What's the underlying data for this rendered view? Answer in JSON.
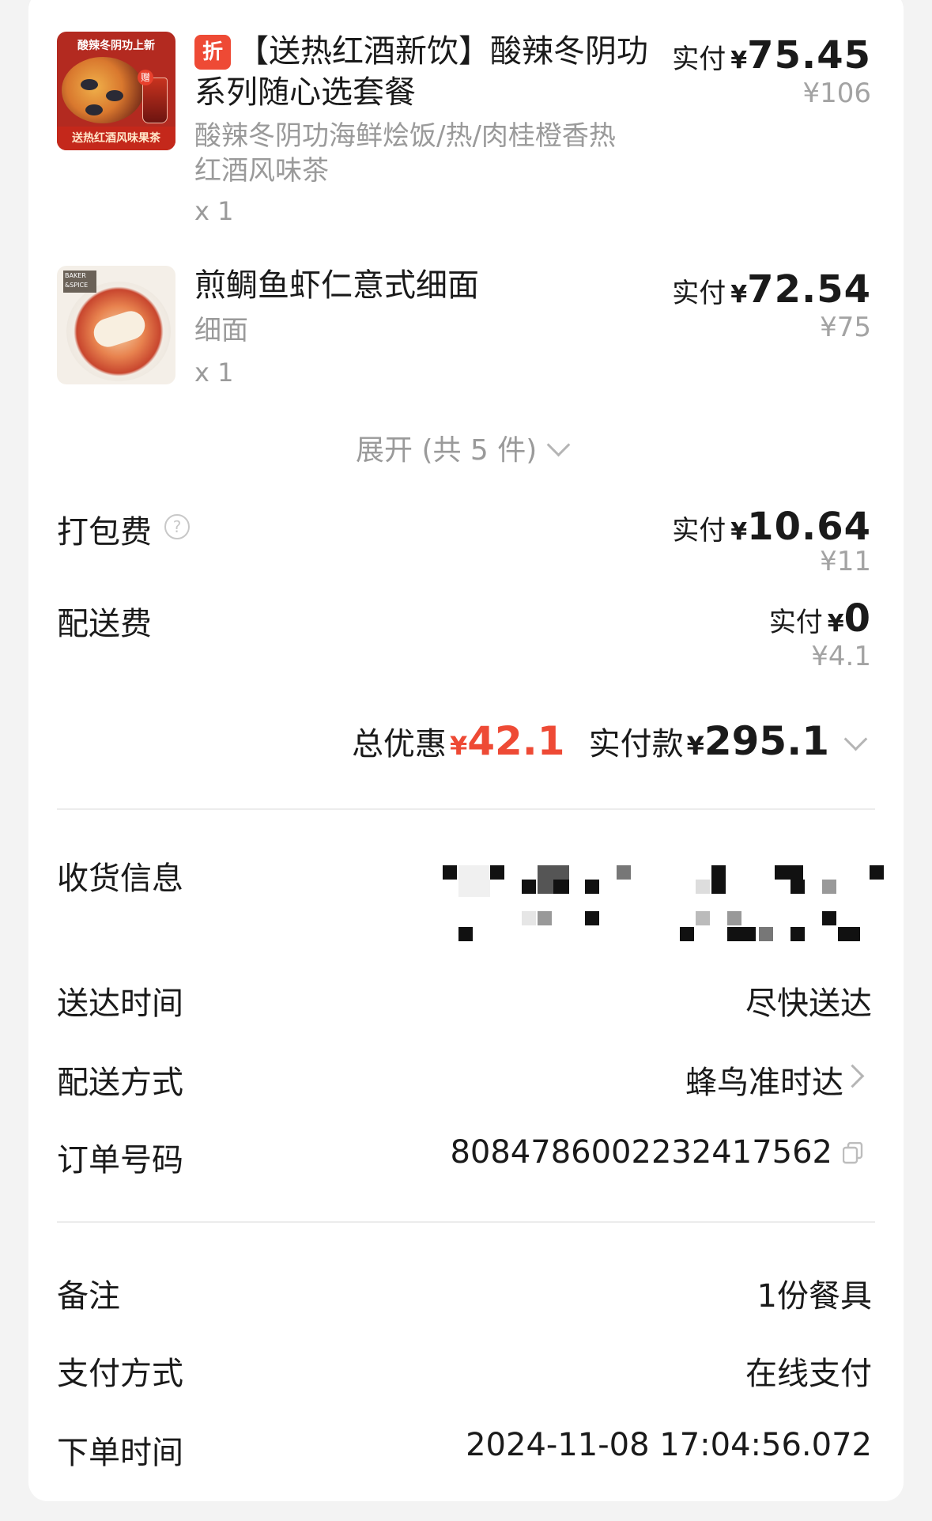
{
  "items": [
    {
      "image_banner_top": "酸辣冬阴功上新",
      "image_banner_bottom": "送热红酒风味果茶",
      "image_gift": "赠",
      "badge": "折",
      "title_line1": "【送热红酒新饮】酸辣冬阴功",
      "title_line2": "系列随心选套餐",
      "spec_line1": "酸辣冬阴功海鲜烩饭/热/肉桂橙香热",
      "spec_line2": "红酒风味茶",
      "qty": "x 1",
      "paid_label": "实付",
      "currency": "¥",
      "paid_amount": "75.45",
      "original_price": "¥106"
    },
    {
      "image_logo": "BAKER &SPICE",
      "title_line1": "煎鲷鱼虾仁意式细面",
      "spec_line1": "细面",
      "qty": "x 1",
      "paid_label": "实付",
      "currency": "¥",
      "paid_amount": "72.54",
      "original_price": "¥75"
    }
  ],
  "expand_label": "展开 (共 5 件)",
  "fees": {
    "packing": {
      "label": "打包费",
      "help_icon": "?",
      "paid_label": "实付",
      "currency": "¥",
      "paid_amount": "10.64",
      "original_price": "¥11"
    },
    "delivery": {
      "label": "配送费",
      "paid_label": "实付",
      "currency": "¥",
      "paid_amount": "0",
      "original_price": "¥4.1"
    }
  },
  "totals": {
    "discount_label": "总优惠",
    "discount_currency": "¥",
    "discount_amount": "42.1",
    "paid_label": "实付款",
    "paid_currency": "¥",
    "paid_amount": "295.1"
  },
  "info": {
    "address_label": "收货信息",
    "arrival_label": "送达时间",
    "arrival_value": "尽快送达",
    "method_label": "配送方式",
    "method_value": "蜂鸟准时达",
    "order_no_label": "订单号码",
    "order_no_value": "8084786002232417562"
  },
  "extra": {
    "note_label": "备注",
    "note_value": "1份餐具",
    "payment_label": "支付方式",
    "payment_value": "在线支付",
    "time_label": "下单时间",
    "time_value": "2024-11-08 17:04:56.072"
  },
  "colors": {
    "accent_red": "#ee4a35",
    "text_dark": "#1a1a1a",
    "text_gray": "#9a9a9a",
    "background": "#f3f3f3"
  },
  "icons": {
    "help": "help-circle-icon",
    "expand": "chevron-down-icon",
    "totals_expand": "chevron-down-icon",
    "method": "chevron-right-icon",
    "copy": "copy-icon"
  }
}
